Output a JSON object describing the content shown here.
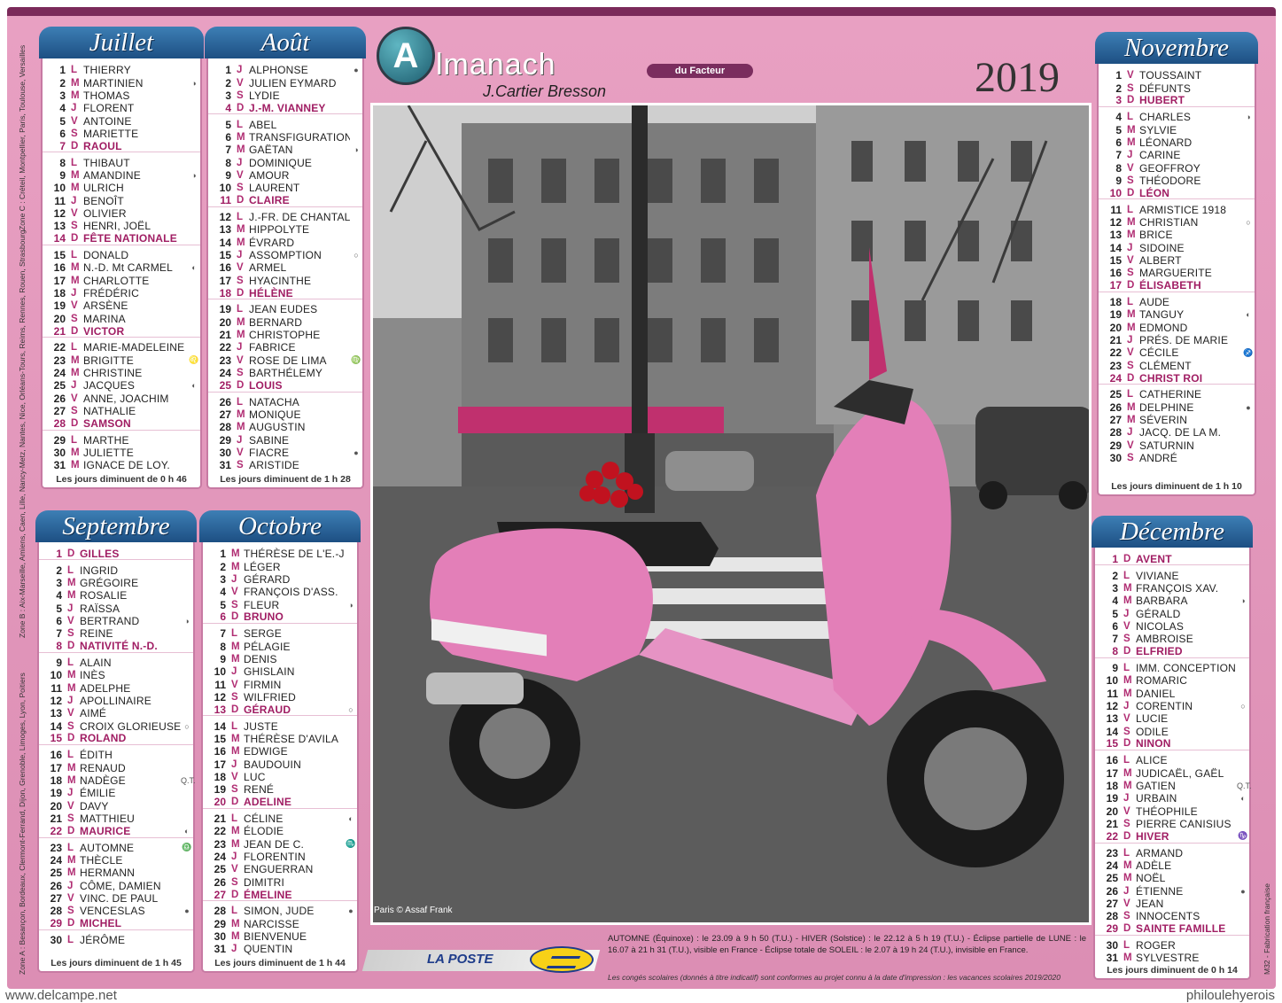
{
  "header": {
    "logo_letter": "A",
    "title": "lmanach",
    "tag": "du Facteur",
    "publisher": "J.Cartier Bresson",
    "year": "2019"
  },
  "months": [
    {
      "key": "juillet",
      "name": "Juillet",
      "days": [
        [
          "1",
          "L",
          "THIERRY",
          ""
        ],
        [
          "2",
          "M",
          "MARTINIEN",
          "◑"
        ],
        [
          "3",
          "M",
          "THOMAS",
          ""
        ],
        [
          "4",
          "J",
          "FLORENT",
          ""
        ],
        [
          "5",
          "V",
          "ANTOINE",
          ""
        ],
        [
          "6",
          "S",
          "MARIETTE",
          ""
        ],
        [
          "7",
          "D",
          "RAOUL",
          ""
        ],
        [
          "8",
          "L",
          "THIBAUT",
          ""
        ],
        [
          "9",
          "M",
          "AMANDINE",
          "◑"
        ],
        [
          "10",
          "M",
          "ULRICH",
          ""
        ],
        [
          "11",
          "J",
          "BENOÎT",
          ""
        ],
        [
          "12",
          "V",
          "OLIVIER",
          ""
        ],
        [
          "13",
          "S",
          "HENRI, JOËL",
          ""
        ],
        [
          "14",
          "D",
          "FÊTE NATIONALE",
          ""
        ],
        [
          "15",
          "L",
          "DONALD",
          ""
        ],
        [
          "16",
          "M",
          "N.-D. Mt CARMEL",
          "◐"
        ],
        [
          "17",
          "M",
          "CHARLOTTE",
          ""
        ],
        [
          "18",
          "J",
          "FRÉDÉRIC",
          ""
        ],
        [
          "19",
          "V",
          "ARSÈNE",
          ""
        ],
        [
          "20",
          "S",
          "MARINA",
          ""
        ],
        [
          "21",
          "D",
          "VICTOR",
          ""
        ],
        [
          "22",
          "L",
          "MARIE-MADELEINE",
          ""
        ],
        [
          "23",
          "M",
          "BRIGITTE",
          "♌"
        ],
        [
          "24",
          "M",
          "CHRISTINE",
          ""
        ],
        [
          "25",
          "J",
          "JACQUES",
          "◐"
        ],
        [
          "26",
          "V",
          "ANNE, JOACHIM",
          ""
        ],
        [
          "27",
          "S",
          "NATHALIE",
          ""
        ],
        [
          "28",
          "D",
          "SAMSON",
          ""
        ],
        [
          "29",
          "L",
          "MARTHE",
          ""
        ],
        [
          "30",
          "M",
          "JULIETTE",
          ""
        ],
        [
          "31",
          "M",
          "IGNACE DE LOY.",
          ""
        ]
      ],
      "footer": "Les jours diminuent de 0 h 46"
    },
    {
      "key": "aout",
      "name": "Août",
      "days": [
        [
          "1",
          "J",
          "ALPHONSE",
          "●"
        ],
        [
          "2",
          "V",
          "JULIEN EYMARD",
          ""
        ],
        [
          "3",
          "S",
          "LYDIE",
          ""
        ],
        [
          "4",
          "D",
          "J.-M. VIANNEY",
          ""
        ],
        [
          "5",
          "L",
          "ABEL",
          ""
        ],
        [
          "6",
          "M",
          "TRANSFIGURATION",
          ""
        ],
        [
          "7",
          "M",
          "GAËTAN",
          "◑"
        ],
        [
          "8",
          "J",
          "DOMINIQUE",
          ""
        ],
        [
          "9",
          "V",
          "AMOUR",
          ""
        ],
        [
          "10",
          "S",
          "LAURENT",
          ""
        ],
        [
          "11",
          "D",
          "CLAIRE",
          ""
        ],
        [
          "12",
          "L",
          "J.-FR. DE CHANTAL",
          ""
        ],
        [
          "13",
          "M",
          "HIPPOLYTE",
          ""
        ],
        [
          "14",
          "M",
          "ÉVRARD",
          ""
        ],
        [
          "15",
          "J",
          "ASSOMPTION",
          "○"
        ],
        [
          "16",
          "V",
          "ARMEL",
          ""
        ],
        [
          "17",
          "S",
          "HYACINTHE",
          ""
        ],
        [
          "18",
          "D",
          "HÉLÈNE",
          ""
        ],
        [
          "19",
          "L",
          "JEAN EUDES",
          ""
        ],
        [
          "20",
          "M",
          "BERNARD",
          ""
        ],
        [
          "21",
          "M",
          "CHRISTOPHE",
          ""
        ],
        [
          "22",
          "J",
          "FABRICE",
          ""
        ],
        [
          "23",
          "V",
          "ROSE DE LIMA",
          "♍"
        ],
        [
          "24",
          "S",
          "BARTHÉLEMY",
          ""
        ],
        [
          "25",
          "D",
          "LOUIS",
          ""
        ],
        [
          "26",
          "L",
          "NATACHA",
          ""
        ],
        [
          "27",
          "M",
          "MONIQUE",
          ""
        ],
        [
          "28",
          "M",
          "AUGUSTIN",
          ""
        ],
        [
          "29",
          "J",
          "SABINE",
          ""
        ],
        [
          "30",
          "V",
          "FIACRE",
          "●"
        ],
        [
          "31",
          "S",
          "ARISTIDE",
          ""
        ]
      ],
      "footer": "Les jours diminuent de 1 h 28"
    },
    {
      "key": "septembre",
      "name": "Septembre",
      "days": [
        [
          "1",
          "D",
          "GILLES",
          ""
        ],
        [
          "2",
          "L",
          "INGRID",
          ""
        ],
        [
          "3",
          "M",
          "GRÉGOIRE",
          ""
        ],
        [
          "4",
          "M",
          "ROSALIE",
          ""
        ],
        [
          "5",
          "J",
          "RAÏSSA",
          ""
        ],
        [
          "6",
          "V",
          "BERTRAND",
          "◑"
        ],
        [
          "7",
          "S",
          "REINE",
          ""
        ],
        [
          "8",
          "D",
          "NATIVITÉ N.-D.",
          ""
        ],
        [
          "9",
          "L",
          "ALAIN",
          ""
        ],
        [
          "10",
          "M",
          "INÈS",
          ""
        ],
        [
          "11",
          "M",
          "ADELPHE",
          ""
        ],
        [
          "12",
          "J",
          "APOLLINAIRE",
          ""
        ],
        [
          "13",
          "V",
          "AIMÉ",
          ""
        ],
        [
          "14",
          "S",
          "CROIX GLORIEUSE",
          "○"
        ],
        [
          "15",
          "D",
          "ROLAND",
          ""
        ],
        [
          "16",
          "L",
          "ÉDITH",
          ""
        ],
        [
          "17",
          "M",
          "RENAUD",
          ""
        ],
        [
          "18",
          "M",
          "NADÈGE",
          "Q.T."
        ],
        [
          "19",
          "J",
          "ÉMILIE",
          ""
        ],
        [
          "20",
          "V",
          "DAVY",
          ""
        ],
        [
          "21",
          "S",
          "MATTHIEU",
          ""
        ],
        [
          "22",
          "D",
          "MAURICE",
          "◐"
        ],
        [
          "23",
          "L",
          "AUTOMNE",
          "♎"
        ],
        [
          "24",
          "M",
          "THÈCLE",
          ""
        ],
        [
          "25",
          "M",
          "HERMANN",
          ""
        ],
        [
          "26",
          "J",
          "CÔME, DAMIEN",
          ""
        ],
        [
          "27",
          "V",
          "VINC. DE PAUL",
          ""
        ],
        [
          "28",
          "S",
          "VENCESLAS",
          "●"
        ],
        [
          "29",
          "D",
          "MICHEL",
          ""
        ],
        [
          "30",
          "L",
          "JÉRÔME",
          ""
        ]
      ],
      "footer": "Les jours diminuent de 1 h 45"
    },
    {
      "key": "octobre",
      "name": "Octobre",
      "days": [
        [
          "1",
          "M",
          "THÉRÈSE DE L'E.-J.",
          ""
        ],
        [
          "2",
          "M",
          "LÉGER",
          ""
        ],
        [
          "3",
          "J",
          "GÉRARD",
          ""
        ],
        [
          "4",
          "V",
          "FRANÇOIS D'ASS.",
          ""
        ],
        [
          "5",
          "S",
          "FLEUR",
          "◑"
        ],
        [
          "6",
          "D",
          "BRUNO",
          ""
        ],
        [
          "7",
          "L",
          "SERGE",
          ""
        ],
        [
          "8",
          "M",
          "PÉLAGIE",
          ""
        ],
        [
          "9",
          "M",
          "DENIS",
          ""
        ],
        [
          "10",
          "J",
          "GHISLAIN",
          ""
        ],
        [
          "11",
          "V",
          "FIRMIN",
          ""
        ],
        [
          "12",
          "S",
          "WILFRIED",
          ""
        ],
        [
          "13",
          "D",
          "GÉRAUD",
          "○"
        ],
        [
          "14",
          "L",
          "JUSTE",
          ""
        ],
        [
          "15",
          "M",
          "THÉRÈSE D'AVILA",
          ""
        ],
        [
          "16",
          "M",
          "EDWIGE",
          ""
        ],
        [
          "17",
          "J",
          "BAUDOUIN",
          ""
        ],
        [
          "18",
          "V",
          "LUC",
          ""
        ],
        [
          "19",
          "S",
          "RENÉ",
          ""
        ],
        [
          "20",
          "D",
          "ADELINE",
          ""
        ],
        [
          "21",
          "L",
          "CÉLINE",
          "◐"
        ],
        [
          "22",
          "M",
          "ÉLODIE",
          ""
        ],
        [
          "23",
          "M",
          "JEAN DE C.",
          "♏"
        ],
        [
          "24",
          "J",
          "FLORENTIN",
          ""
        ],
        [
          "25",
          "V",
          "ENGUERRAN",
          ""
        ],
        [
          "26",
          "S",
          "DIMITRI",
          ""
        ],
        [
          "27",
          "D",
          "ÉMELINE",
          ""
        ],
        [
          "28",
          "L",
          "SIMON, JUDE",
          "●"
        ],
        [
          "29",
          "M",
          "NARCISSE",
          ""
        ],
        [
          "30",
          "M",
          "BIENVENUE",
          ""
        ],
        [
          "31",
          "J",
          "QUENTIN",
          ""
        ]
      ],
      "footer": "Les jours diminuent de 1 h 44"
    },
    {
      "key": "novembre",
      "name": "Novembre",
      "days": [
        [
          "1",
          "V",
          "TOUSSAINT",
          ""
        ],
        [
          "2",
          "S",
          "DÉFUNTS",
          ""
        ],
        [
          "3",
          "D",
          "HUBERT",
          ""
        ],
        [
          "4",
          "L",
          "CHARLES",
          "◑"
        ],
        [
          "5",
          "M",
          "SYLVIE",
          ""
        ],
        [
          "6",
          "M",
          "LÉONARD",
          ""
        ],
        [
          "7",
          "J",
          "CARINE",
          ""
        ],
        [
          "8",
          "V",
          "GEOFFROY",
          ""
        ],
        [
          "9",
          "S",
          "THÉODORE",
          ""
        ],
        [
          "10",
          "D",
          "LÉON",
          ""
        ],
        [
          "11",
          "L",
          "ARMISTICE 1918",
          ""
        ],
        [
          "12",
          "M",
          "CHRISTIAN",
          "○"
        ],
        [
          "13",
          "M",
          "BRICE",
          ""
        ],
        [
          "14",
          "J",
          "SIDOINE",
          ""
        ],
        [
          "15",
          "V",
          "ALBERT",
          ""
        ],
        [
          "16",
          "S",
          "MARGUERITE",
          ""
        ],
        [
          "17",
          "D",
          "ÉLISABETH",
          ""
        ],
        [
          "18",
          "L",
          "AUDE",
          ""
        ],
        [
          "19",
          "M",
          "TANGUY",
          "◐"
        ],
        [
          "20",
          "M",
          "EDMOND",
          ""
        ],
        [
          "21",
          "J",
          "PRÉS. DE MARIE",
          ""
        ],
        [
          "22",
          "V",
          "CÉCILE",
          "♐"
        ],
        [
          "23",
          "S",
          "CLÉMENT",
          ""
        ],
        [
          "24",
          "D",
          "CHRIST ROI",
          ""
        ],
        [
          "25",
          "L",
          "CATHERINE",
          ""
        ],
        [
          "26",
          "M",
          "DELPHINE",
          "●"
        ],
        [
          "27",
          "M",
          "SÉVERIN",
          ""
        ],
        [
          "28",
          "J",
          "JACQ. DE LA M.",
          ""
        ],
        [
          "29",
          "V",
          "SATURNIN",
          ""
        ],
        [
          "30",
          "S",
          "ANDRÉ",
          ""
        ]
      ],
      "footer": "Les jours diminuent de 1 h 10"
    },
    {
      "key": "decembre",
      "name": "Décembre",
      "days": [
        [
          "1",
          "D",
          "AVENT",
          ""
        ],
        [
          "2",
          "L",
          "VIVIANE",
          ""
        ],
        [
          "3",
          "M",
          "FRANÇOIS XAV.",
          ""
        ],
        [
          "4",
          "M",
          "BARBARA",
          "◑"
        ],
        [
          "5",
          "J",
          "GÉRALD",
          ""
        ],
        [
          "6",
          "V",
          "NICOLAS",
          ""
        ],
        [
          "7",
          "S",
          "AMBROISE",
          ""
        ],
        [
          "8",
          "D",
          "ELFRIED",
          ""
        ],
        [
          "9",
          "L",
          "IMM. CONCEPTION",
          ""
        ],
        [
          "10",
          "M",
          "ROMARIC",
          ""
        ],
        [
          "11",
          "M",
          "DANIEL",
          ""
        ],
        [
          "12",
          "J",
          "CORENTIN",
          "○"
        ],
        [
          "13",
          "V",
          "LUCIE",
          ""
        ],
        [
          "14",
          "S",
          "ODILE",
          ""
        ],
        [
          "15",
          "D",
          "NINON",
          ""
        ],
        [
          "16",
          "L",
          "ALICE",
          ""
        ],
        [
          "17",
          "M",
          "JUDICAËL, GAËL",
          ""
        ],
        [
          "18",
          "M",
          "GATIEN",
          "Q.T."
        ],
        [
          "19",
          "J",
          "URBAIN",
          "◐"
        ],
        [
          "20",
          "V",
          "THÉOPHILE",
          ""
        ],
        [
          "21",
          "S",
          "PIERRE CANISIUS",
          ""
        ],
        [
          "22",
          "D",
          "HIVER",
          "♑"
        ],
        [
          "23",
          "L",
          "ARMAND",
          ""
        ],
        [
          "24",
          "M",
          "ADÈLE",
          ""
        ],
        [
          "25",
          "M",
          "NOËL",
          ""
        ],
        [
          "26",
          "J",
          "ÉTIENNE",
          "●"
        ],
        [
          "27",
          "V",
          "JEAN",
          ""
        ],
        [
          "28",
          "S",
          "INNOCENTS",
          ""
        ],
        [
          "29",
          "D",
          "SAINTE FAMILLE",
          ""
        ],
        [
          "30",
          "L",
          "ROGER",
          ""
        ],
        [
          "31",
          "M",
          "SYLVESTRE",
          ""
        ]
      ],
      "footer": "Les jours diminuent de 0 h 14"
    }
  ],
  "photo": {
    "credit": "Paris © Assaf Frank"
  },
  "footer": {
    "la_poste": "LA POSTE",
    "seasons": "AUTOMNE (Équinoxe) : le 23.09 à 9 h 50 (T.U.) - HIVER (Solstice) : le 22.12 à 5 h 19 (T.U.) - Éclipse partielle de LUNE : le 16.07 à 21 h 31 (T.U.), visible en France - Éclipse totale de SOLEIL : le 2.07 à 19 h 24 (T.U.), invisible en France.",
    "school": "Les congés scolaires (donnés à titre indicatif) sont conformes au projet connu à la date d'impression : les vacances scolaires 2019/2020",
    "side_code": "M32 - Fabrication française",
    "zones": "Zone A : Besançon, Bordeaux, Clermont-Ferrand, Dijon, Grenoble, Limoges, Lyon, Poitiers",
    "zones_b": "Zone B : Aix-Marseille, Amiens, Caen, Lille, Nancy-Metz, Nantes, Nice, Orléans-Tours, Reims, Rennes, Rouen, Strasbourg",
    "zones_c": "Zone C : Créteil, Montpellier, Paris, Toulouse, Versailles"
  },
  "watermark": {
    "left": "www.delcampe.net",
    "right": "philoulehyerois"
  }
}
